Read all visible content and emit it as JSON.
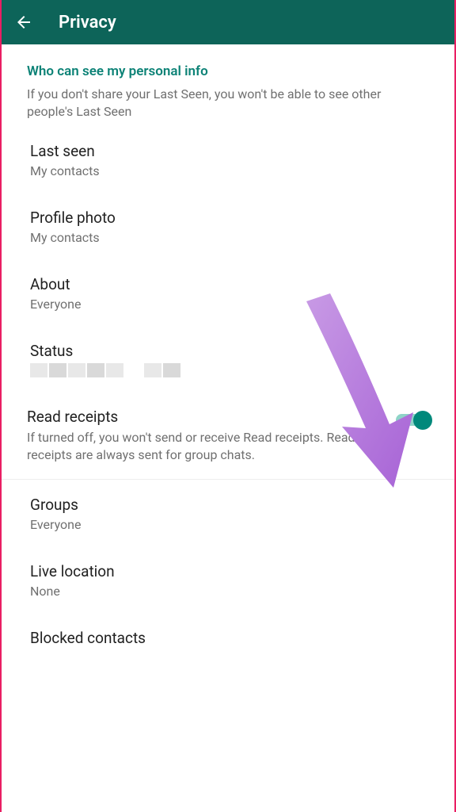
{
  "header": {
    "title": "Privacy"
  },
  "section": {
    "heading": "Who can see my personal info",
    "description": "If you don't share your Last Seen, you won't be able to see other people's Last Seen"
  },
  "items": {
    "last_seen": {
      "title": "Last seen",
      "value": "My contacts"
    },
    "profile_photo": {
      "title": "Profile photo",
      "value": "My contacts"
    },
    "about": {
      "title": "About",
      "value": "Everyone"
    },
    "status": {
      "title": "Status"
    },
    "read_receipts": {
      "title": "Read receipts",
      "description": "If turned off, you won't send or receive Read receipts. Read receipts are always sent for group chats.",
      "enabled": true
    },
    "groups": {
      "title": "Groups",
      "value": "Everyone"
    },
    "live_location": {
      "title": "Live location",
      "value": "None"
    },
    "blocked": {
      "title": "Blocked contacts"
    }
  },
  "annotation": {
    "arrow_color": "#b77ee0"
  }
}
